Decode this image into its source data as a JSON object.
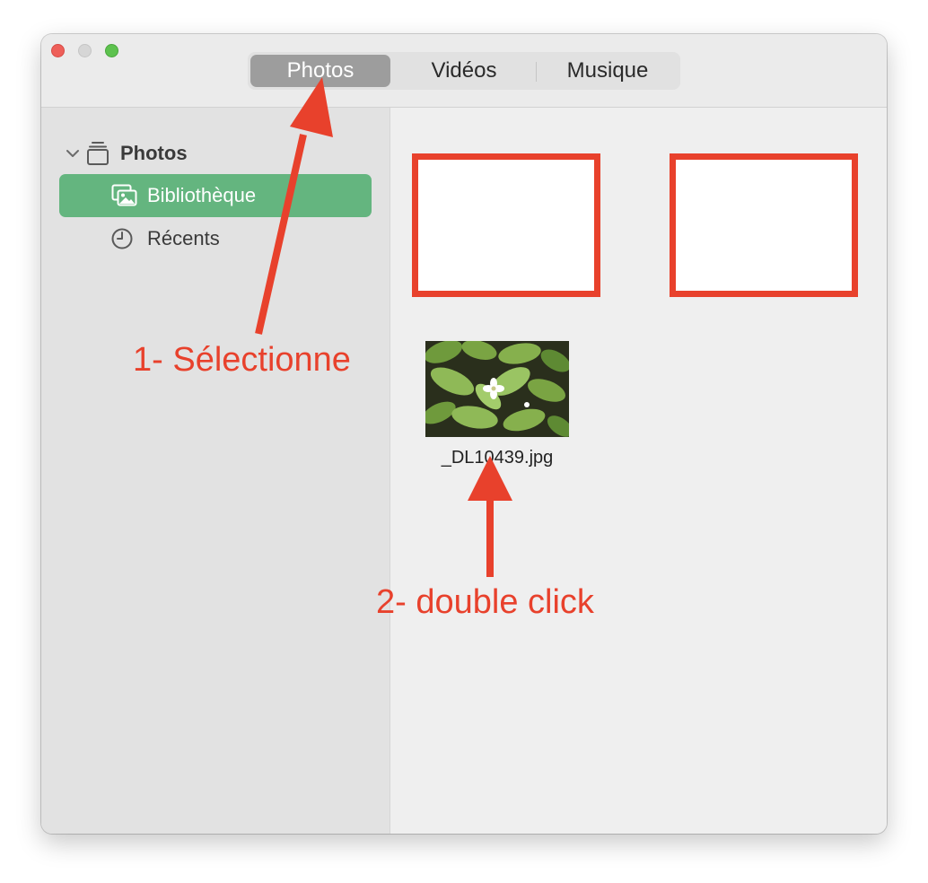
{
  "window": {
    "traffic_lights": [
      "close",
      "minimize",
      "zoom"
    ]
  },
  "tabs": [
    {
      "label": "Photos",
      "selected": true
    },
    {
      "label": "Vidéos",
      "selected": false
    },
    {
      "label": "Musique",
      "selected": false
    }
  ],
  "sidebar": {
    "section_label": "Photos",
    "section_icon": "photo-stack-icon",
    "chevron_icon": "chevron-down-icon",
    "items": [
      {
        "label": "Bibliothèque",
        "icon": "photo-library-icon",
        "selected": true
      },
      {
        "label": "Récents",
        "icon": "clock-icon",
        "selected": false
      }
    ]
  },
  "content": {
    "file": {
      "name": "_DL10439.jpg"
    }
  },
  "annotations": {
    "step1": "1- Sélectionne",
    "step2": "2- double click",
    "color": "#e8412c"
  },
  "colors": {
    "selection_green": "#64b57f",
    "segment_active": "#9d9d9d",
    "annotation_red": "#e8412c"
  }
}
